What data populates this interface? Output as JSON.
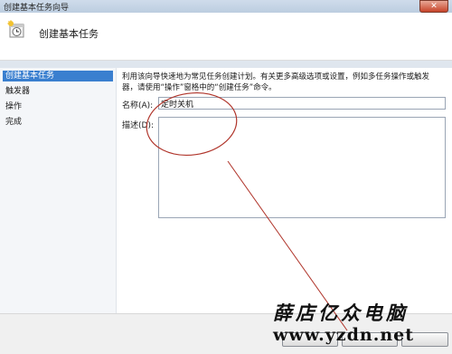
{
  "window": {
    "title": "创建基本任务向导",
    "close_glyph": "✕"
  },
  "header": {
    "title": "创建基本任务",
    "icon": "task-wizard-icon"
  },
  "sidebar": {
    "items": [
      {
        "label": "创建基本任务",
        "active": true
      },
      {
        "label": "触发器",
        "active": false
      },
      {
        "label": "操作",
        "active": false
      },
      {
        "label": "完成",
        "active": false
      }
    ]
  },
  "main": {
    "description_line1": "利用该向导快速地为常见任务创建计划。有关更多高级选项或设置，例如多任务操作或触发",
    "description_line2": "器，请使用“操作”窗格中的“创建任务”命令。",
    "name_label": "名称(A):",
    "name_value": "定时关机",
    "desc_label": "描述(D):",
    "desc_value": ""
  },
  "watermark": {
    "line1": "薛店亿众电脑",
    "line2": "www.yzdn.net"
  },
  "colors": {
    "selection": "#3a7fcf",
    "annotation": "#b0352b"
  }
}
